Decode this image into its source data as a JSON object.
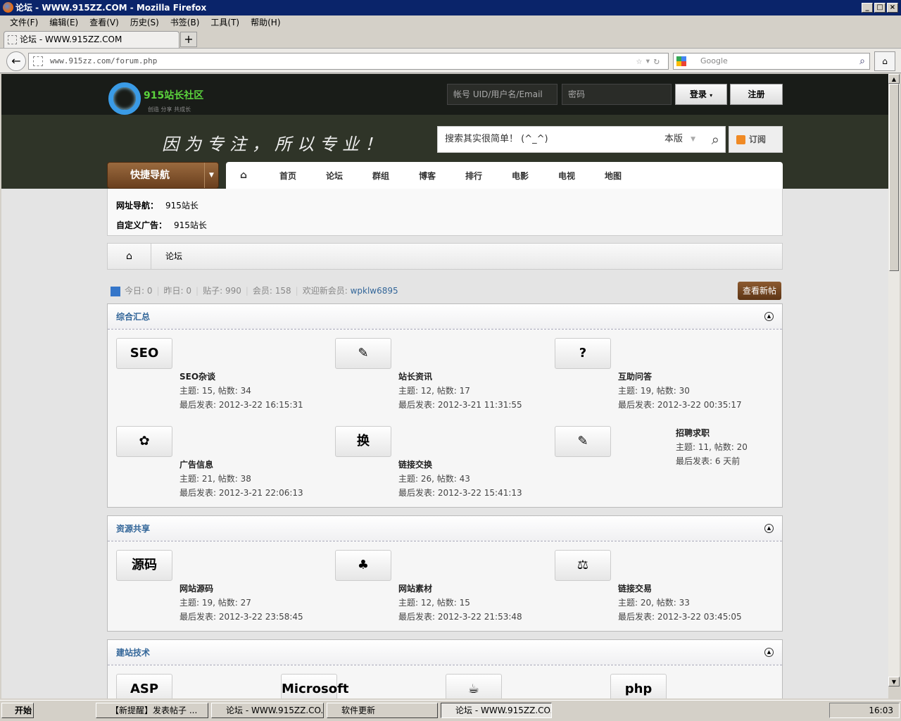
{
  "window": {
    "title": "论坛 - WWW.915ZZ.COM - Mozilla Firefox"
  },
  "menu": [
    "文件(F)",
    "编辑(E)",
    "查看(V)",
    "历史(S)",
    "书签(B)",
    "工具(T)",
    "帮助(H)"
  ],
  "tab": {
    "label": "论坛 - WWW.915ZZ.COM",
    "new": "+"
  },
  "url": "www.915zz.com/forum.php",
  "search_engine": "Google",
  "site": {
    "logo_text": "915站长社区",
    "logo_sub": "创造 分享 共成长",
    "account_placeholder": "帐号   UID/用户名/Email",
    "password_placeholder": "密码",
    "login": "登录",
    "register": "注册",
    "slogan": "因为专注，所以专业！",
    "search_placeholder": "搜索其实很简单！ (^_^)",
    "search_scope": "本版",
    "subscribe": "订阅",
    "quick_nav": "快捷导航",
    "nav": [
      "首页",
      "论坛",
      "群组",
      "博客",
      "排行",
      "电影",
      "电视",
      "地图"
    ],
    "subnav": [
      {
        "label": "网址导航：",
        "value": "915站长"
      },
      {
        "label": "自定义广告：",
        "value": "915站长"
      }
    ],
    "breadcrumb": "论坛",
    "stats": {
      "today": "今日: 0",
      "yesterday": "昨日: 0",
      "posts": "贴子: 990",
      "members": "会员: 158",
      "welcome": "欢迎新会员: ",
      "new_member": "wpklw6895"
    },
    "new_posts": "查看新帖"
  },
  "sections": [
    {
      "title": "综合汇总",
      "forums": [
        {
          "name": "SEO杂谈",
          "icon": "SEO",
          "stats": "主题: 15, 帖数: 34",
          "last": "最后发表: 2012-3-22 16:15:31"
        },
        {
          "name": "站长资讯",
          "icon": "✎",
          "stats": "主题: 12, 帖数: 17",
          "last": "最后发表: 2012-3-21 11:31:55"
        },
        {
          "name": "互助问答",
          "icon": "?",
          "stats": "主题: 19, 帖数: 30",
          "last": "最后发表: 2012-3-22 00:35:17"
        },
        {
          "name": "广告信息",
          "icon": "✿",
          "stats": "主题: 21, 帖数: 38",
          "last": "最后发表: 2012-3-21 22:06:13"
        },
        {
          "name": "链接交换",
          "icon": "换",
          "stats": "主题: 26, 帖数: 43",
          "last": "最后发表: 2012-3-22 15:41:13"
        },
        {
          "name": "招聘求职",
          "icon": "✎",
          "stats": "主题: 11, 帖数: 20",
          "last": "最后发表: 6 天前"
        }
      ]
    },
    {
      "title": "资源共享",
      "forums": [
        {
          "name": "网站源码",
          "icon": "源码",
          "stats": "主题: 19, 帖数: 27",
          "last": "最后发表: 2012-3-22 23:58:45"
        },
        {
          "name": "网站素材",
          "icon": "♣",
          "stats": "主题: 12, 帖数: 15",
          "last": "最后发表: 2012-3-22 21:53:48"
        },
        {
          "name": "链接交易",
          "icon": "⚖",
          "stats": "主题: 20, 帖数: 33",
          "last": "最后发表: 2012-3-22 03:45:05"
        }
      ]
    },
    {
      "title": "建站技术",
      "forums": [
        {
          "icon": "ASP"
        },
        {
          "icon": "Microsoft .net"
        },
        {
          "icon": "☕"
        },
        {
          "icon": "php"
        }
      ]
    }
  ],
  "taskbar": {
    "start": "开始",
    "items": [
      "【新提醒】发表帖子 ...",
      "论坛 - WWW.915ZZ.CO...",
      "软件更新",
      "论坛 - WWW.915ZZ.CO..."
    ],
    "clock": "16:03"
  }
}
